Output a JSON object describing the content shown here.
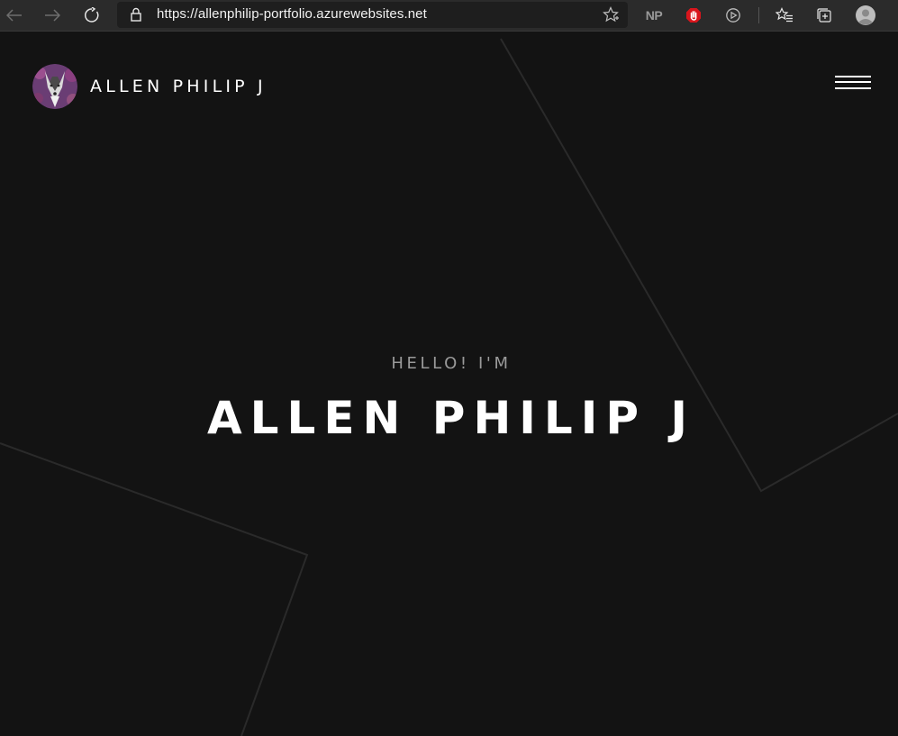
{
  "browser": {
    "url": "https://allenphilip-portfolio.azurewebsites.net",
    "extensions": {
      "np_label": "NP"
    },
    "icons": [
      "back-arrow-icon",
      "forward-arrow-icon",
      "refresh-icon",
      "lock-icon",
      "star-icon",
      "stop-hand-icon",
      "media-icon",
      "favorites-icon",
      "collections-icon",
      "profile-icon"
    ]
  },
  "site": {
    "brand_name": "ALLEN PHILIP J",
    "greeting": "HELLO! I'M",
    "hero_name": "ALLEN PHILIP J"
  },
  "colors": {
    "page_background": "#131313",
    "browser_bar": "#2b2b2b",
    "hero_text": "#ffffff",
    "greeting_text": "#9a9a9a",
    "extension_red": "#d9151c"
  }
}
